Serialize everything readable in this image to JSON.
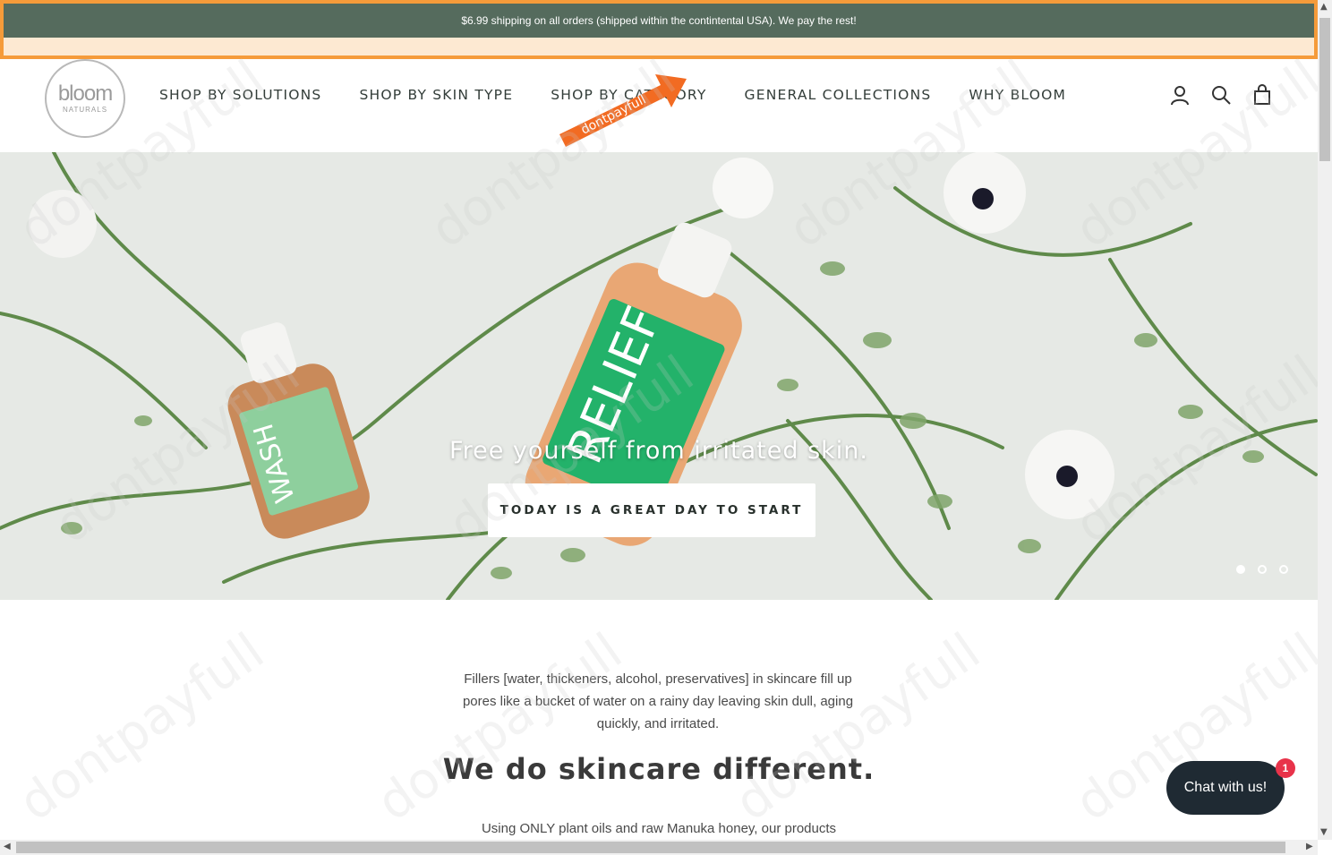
{
  "announcement": {
    "text": "$6.99 shipping on all orders (shipped within the contintental USA). We pay the rest!"
  },
  "logo": {
    "word": "bloom",
    "sub": "NATURALS"
  },
  "nav": {
    "items": [
      "SHOP BY SOLUTIONS",
      "SHOP BY SKIN TYPE",
      "SHOP BY CATEGORY",
      "GENERAL COLLECTIONS",
      "WHY BLOOM"
    ]
  },
  "header_icons": [
    "account-icon",
    "search-icon",
    "cart-icon"
  ],
  "promo": {
    "label": "dontpayfull"
  },
  "hero": {
    "headline": "Free yourself from irritated skin.",
    "cta": "TODAY IS A GREAT DAY TO START",
    "bottle_labels": [
      "WASH",
      "RELIEF"
    ],
    "slides_count": 3,
    "active_slide": 1
  },
  "content": {
    "intro": "Fillers [water, thickeners, alcohol, preservatives] in skincare fill up pores like a bucket of water on a rainy day leaving skin dull, aging quickly, and irritated.",
    "headline": "We do skincare different.",
    "intro2": "Using ONLY plant oils and raw Manuka honey, our products"
  },
  "chat": {
    "label": "Chat with us!",
    "badge": "1"
  },
  "watermark": "dontpayfull",
  "colors": {
    "announcement_bg": "#556b5d",
    "announcement_border": "#f59b3a",
    "cta_bg": "#ffffff",
    "chat_bg": "#1f2a33",
    "badge": "#e8334a",
    "arrow": "#f26b22"
  }
}
